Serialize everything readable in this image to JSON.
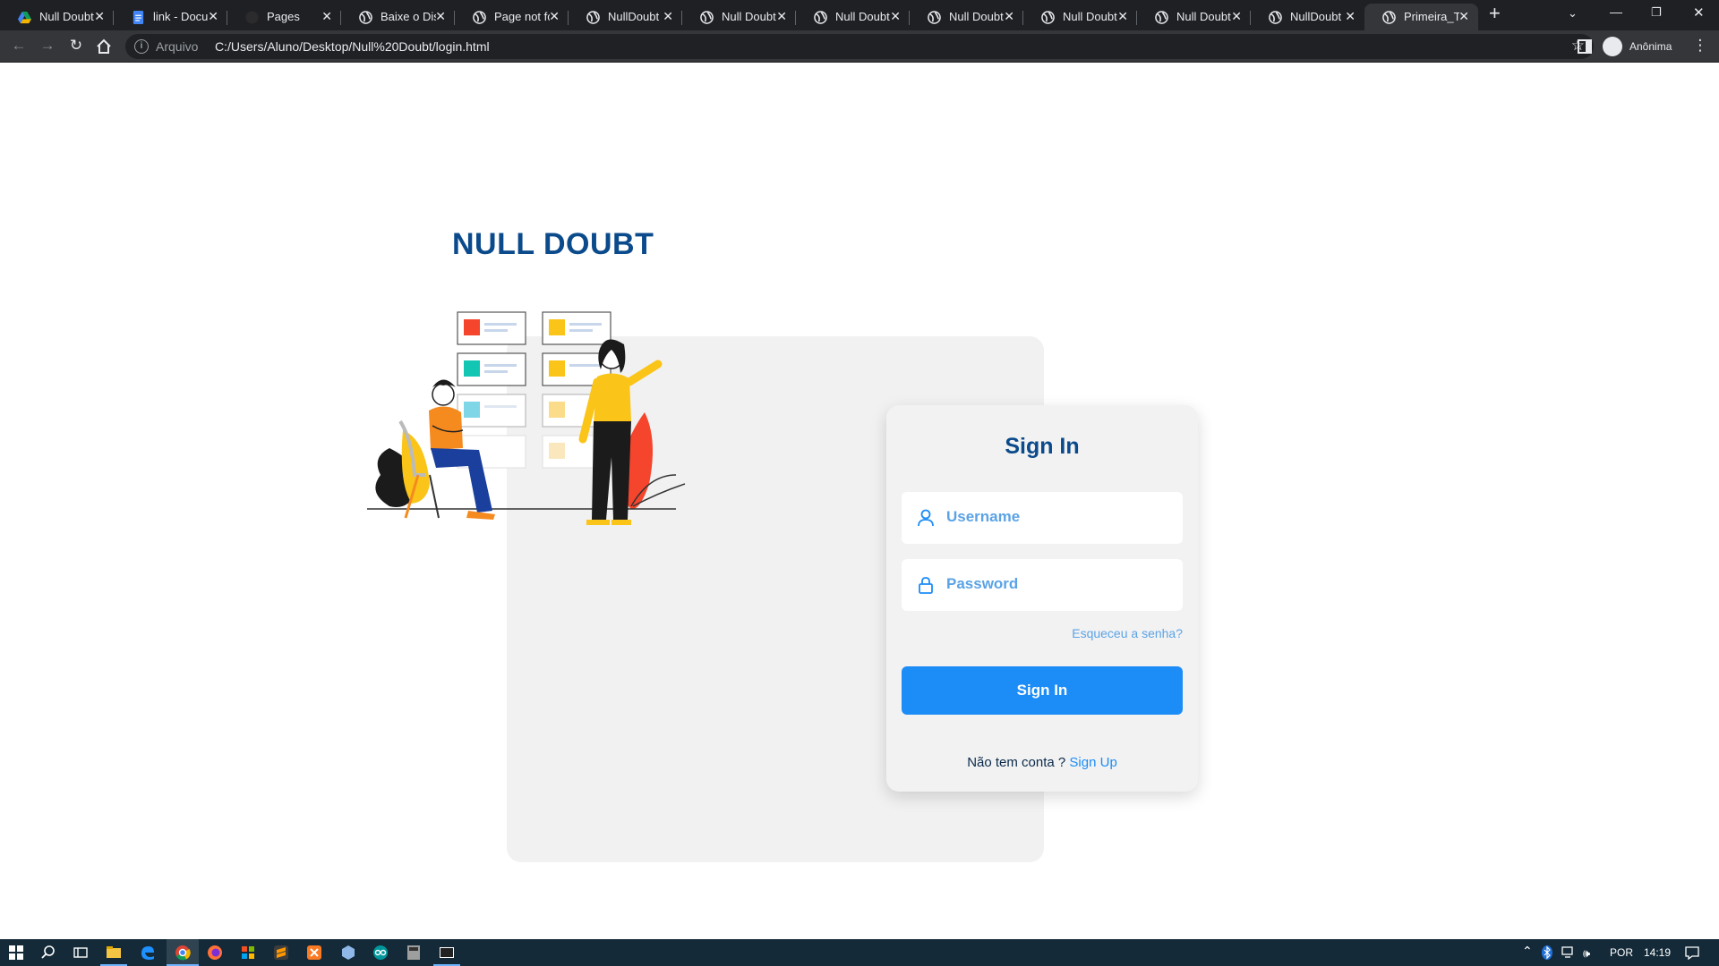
{
  "browser": {
    "tabs": [
      {
        "title": "Null Doubt",
        "icon": "google-drive-icon"
      },
      {
        "title": "link - Docum",
        "icon": "google-docs-icon"
      },
      {
        "title": "Pages",
        "icon": "github-icon"
      },
      {
        "title": "Baixe o Disc",
        "icon": "globe-icon"
      },
      {
        "title": "Page not fo",
        "icon": "globe-icon"
      },
      {
        "title": "NullDoubt",
        "icon": "globe-icon"
      },
      {
        "title": "Null Doubt",
        "icon": "globe-icon"
      },
      {
        "title": "Null Doubt",
        "icon": "globe-icon"
      },
      {
        "title": "Null Doubt",
        "icon": "globe-icon"
      },
      {
        "title": "Null Doubt",
        "icon": "globe-icon"
      },
      {
        "title": "Null Doubt",
        "icon": "globe-icon"
      },
      {
        "title": "NullDoubt",
        "icon": "globe-icon"
      },
      {
        "title": "Primeira_Te",
        "icon": "globe-icon",
        "active": true
      }
    ],
    "address": {
      "scheme_label": "Arquivo",
      "url": "C:/Users/Aluno/Desktop/Null%20Doubt/login.html"
    },
    "profile_label": "Anônima"
  },
  "page": {
    "brand": "NULL DOUBT",
    "login": {
      "title": "Sign In",
      "username_placeholder": "Username",
      "password_placeholder": "Password",
      "forgot_label": "Esqueceu a senha?",
      "submit_label": "Sign In",
      "no_account_text": "Não tem conta ?",
      "signup_label": "Sign Up"
    },
    "colors": {
      "brand": "#0b4a8b",
      "accent": "#1c8cf7",
      "placeholder": "#5ba3e6",
      "card_bg": "#f2f2f2"
    }
  },
  "taskbar": {
    "language": "POR",
    "time": "14:19"
  }
}
